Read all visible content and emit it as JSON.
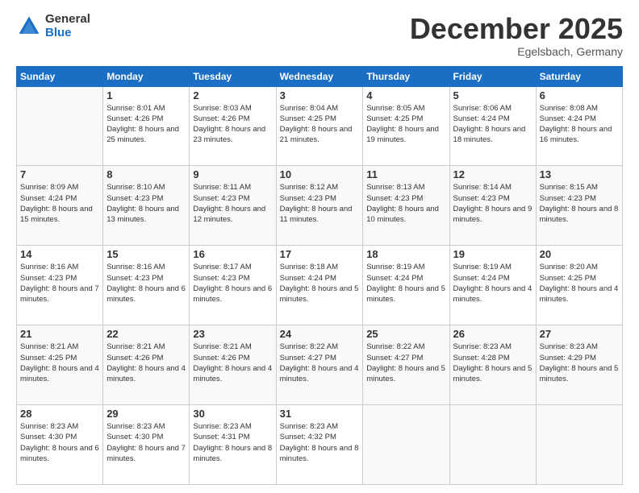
{
  "logo": {
    "general": "General",
    "blue": "Blue"
  },
  "header": {
    "month": "December 2025",
    "location": "Egelsbach, Germany"
  },
  "days_of_week": [
    "Sunday",
    "Monday",
    "Tuesday",
    "Wednesday",
    "Thursday",
    "Friday",
    "Saturday"
  ],
  "weeks": [
    [
      {
        "day": "",
        "sunrise": "",
        "sunset": "",
        "daylight": ""
      },
      {
        "day": "1",
        "sunrise": "Sunrise: 8:01 AM",
        "sunset": "Sunset: 4:26 PM",
        "daylight": "Daylight: 8 hours and 25 minutes."
      },
      {
        "day": "2",
        "sunrise": "Sunrise: 8:03 AM",
        "sunset": "Sunset: 4:26 PM",
        "daylight": "Daylight: 8 hours and 23 minutes."
      },
      {
        "day": "3",
        "sunrise": "Sunrise: 8:04 AM",
        "sunset": "Sunset: 4:25 PM",
        "daylight": "Daylight: 8 hours and 21 minutes."
      },
      {
        "day": "4",
        "sunrise": "Sunrise: 8:05 AM",
        "sunset": "Sunset: 4:25 PM",
        "daylight": "Daylight: 8 hours and 19 minutes."
      },
      {
        "day": "5",
        "sunrise": "Sunrise: 8:06 AM",
        "sunset": "Sunset: 4:24 PM",
        "daylight": "Daylight: 8 hours and 18 minutes."
      },
      {
        "day": "6",
        "sunrise": "Sunrise: 8:08 AM",
        "sunset": "Sunset: 4:24 PM",
        "daylight": "Daylight: 8 hours and 16 minutes."
      }
    ],
    [
      {
        "day": "7",
        "sunrise": "Sunrise: 8:09 AM",
        "sunset": "Sunset: 4:24 PM",
        "daylight": "Daylight: 8 hours and 15 minutes."
      },
      {
        "day": "8",
        "sunrise": "Sunrise: 8:10 AM",
        "sunset": "Sunset: 4:23 PM",
        "daylight": "Daylight: 8 hours and 13 minutes."
      },
      {
        "day": "9",
        "sunrise": "Sunrise: 8:11 AM",
        "sunset": "Sunset: 4:23 PM",
        "daylight": "Daylight: 8 hours and 12 minutes."
      },
      {
        "day": "10",
        "sunrise": "Sunrise: 8:12 AM",
        "sunset": "Sunset: 4:23 PM",
        "daylight": "Daylight: 8 hours and 11 minutes."
      },
      {
        "day": "11",
        "sunrise": "Sunrise: 8:13 AM",
        "sunset": "Sunset: 4:23 PM",
        "daylight": "Daylight: 8 hours and 10 minutes."
      },
      {
        "day": "12",
        "sunrise": "Sunrise: 8:14 AM",
        "sunset": "Sunset: 4:23 PM",
        "daylight": "Daylight: 8 hours and 9 minutes."
      },
      {
        "day": "13",
        "sunrise": "Sunrise: 8:15 AM",
        "sunset": "Sunset: 4:23 PM",
        "daylight": "Daylight: 8 hours and 8 minutes."
      }
    ],
    [
      {
        "day": "14",
        "sunrise": "Sunrise: 8:16 AM",
        "sunset": "Sunset: 4:23 PM",
        "daylight": "Daylight: 8 hours and 7 minutes."
      },
      {
        "day": "15",
        "sunrise": "Sunrise: 8:16 AM",
        "sunset": "Sunset: 4:23 PM",
        "daylight": "Daylight: 8 hours and 6 minutes."
      },
      {
        "day": "16",
        "sunrise": "Sunrise: 8:17 AM",
        "sunset": "Sunset: 4:23 PM",
        "daylight": "Daylight: 8 hours and 6 minutes."
      },
      {
        "day": "17",
        "sunrise": "Sunrise: 8:18 AM",
        "sunset": "Sunset: 4:24 PM",
        "daylight": "Daylight: 8 hours and 5 minutes."
      },
      {
        "day": "18",
        "sunrise": "Sunrise: 8:19 AM",
        "sunset": "Sunset: 4:24 PM",
        "daylight": "Daylight: 8 hours and 5 minutes."
      },
      {
        "day": "19",
        "sunrise": "Sunrise: 8:19 AM",
        "sunset": "Sunset: 4:24 PM",
        "daylight": "Daylight: 8 hours and 4 minutes."
      },
      {
        "day": "20",
        "sunrise": "Sunrise: 8:20 AM",
        "sunset": "Sunset: 4:25 PM",
        "daylight": "Daylight: 8 hours and 4 minutes."
      }
    ],
    [
      {
        "day": "21",
        "sunrise": "Sunrise: 8:21 AM",
        "sunset": "Sunset: 4:25 PM",
        "daylight": "Daylight: 8 hours and 4 minutes."
      },
      {
        "day": "22",
        "sunrise": "Sunrise: 8:21 AM",
        "sunset": "Sunset: 4:26 PM",
        "daylight": "Daylight: 8 hours and 4 minutes."
      },
      {
        "day": "23",
        "sunrise": "Sunrise: 8:21 AM",
        "sunset": "Sunset: 4:26 PM",
        "daylight": "Daylight: 8 hours and 4 minutes."
      },
      {
        "day": "24",
        "sunrise": "Sunrise: 8:22 AM",
        "sunset": "Sunset: 4:27 PM",
        "daylight": "Daylight: 8 hours and 4 minutes."
      },
      {
        "day": "25",
        "sunrise": "Sunrise: 8:22 AM",
        "sunset": "Sunset: 4:27 PM",
        "daylight": "Daylight: 8 hours and 5 minutes."
      },
      {
        "day": "26",
        "sunrise": "Sunrise: 8:23 AM",
        "sunset": "Sunset: 4:28 PM",
        "daylight": "Daylight: 8 hours and 5 minutes."
      },
      {
        "day": "27",
        "sunrise": "Sunrise: 8:23 AM",
        "sunset": "Sunset: 4:29 PM",
        "daylight": "Daylight: 8 hours and 5 minutes."
      }
    ],
    [
      {
        "day": "28",
        "sunrise": "Sunrise: 8:23 AM",
        "sunset": "Sunset: 4:30 PM",
        "daylight": "Daylight: 8 hours and 6 minutes."
      },
      {
        "day": "29",
        "sunrise": "Sunrise: 8:23 AM",
        "sunset": "Sunset: 4:30 PM",
        "daylight": "Daylight: 8 hours and 7 minutes."
      },
      {
        "day": "30",
        "sunrise": "Sunrise: 8:23 AM",
        "sunset": "Sunset: 4:31 PM",
        "daylight": "Daylight: 8 hours and 8 minutes."
      },
      {
        "day": "31",
        "sunrise": "Sunrise: 8:23 AM",
        "sunset": "Sunset: 4:32 PM",
        "daylight": "Daylight: 8 hours and 8 minutes."
      },
      {
        "day": "",
        "sunrise": "",
        "sunset": "",
        "daylight": ""
      },
      {
        "day": "",
        "sunrise": "",
        "sunset": "",
        "daylight": ""
      },
      {
        "day": "",
        "sunrise": "",
        "sunset": "",
        "daylight": ""
      }
    ]
  ]
}
